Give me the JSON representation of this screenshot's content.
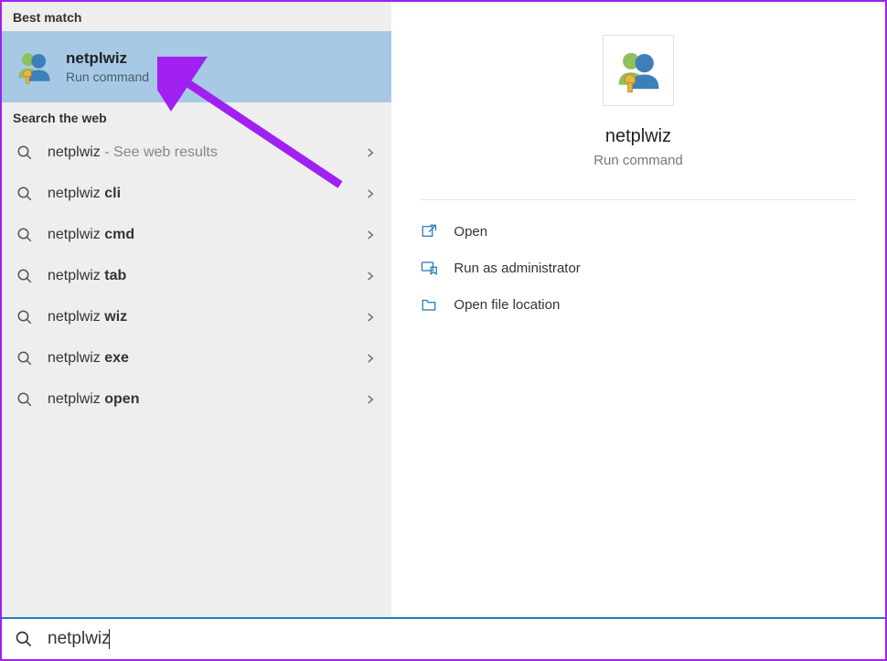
{
  "colors": {
    "accent": "#a020f0",
    "highlight": "#a7c9e6",
    "action_icon": "#1976b2"
  },
  "left": {
    "best_match_header": "Best match",
    "best_match": {
      "title": "netplwiz",
      "subtitle": "Run command"
    },
    "web_header": "Search the web",
    "web_results": [
      {
        "prefix": "netplwiz",
        "bold": "",
        "suffix": " - See web results",
        "suffix_muted": true
      },
      {
        "prefix": "netplwiz ",
        "bold": "cli",
        "suffix": ""
      },
      {
        "prefix": "netplwiz ",
        "bold": "cmd",
        "suffix": ""
      },
      {
        "prefix": "netplwiz ",
        "bold": "tab",
        "suffix": ""
      },
      {
        "prefix": "netplwiz ",
        "bold": "wiz",
        "suffix": ""
      },
      {
        "prefix": "netplwiz ",
        "bold": "exe",
        "suffix": ""
      },
      {
        "prefix": "netplwiz ",
        "bold": "open",
        "suffix": ""
      }
    ]
  },
  "right": {
    "title": "netplwiz",
    "subtitle": "Run command",
    "actions": [
      {
        "icon": "open",
        "label": "Open"
      },
      {
        "icon": "admin",
        "label": "Run as administrator"
      },
      {
        "icon": "folder",
        "label": "Open file location"
      }
    ]
  },
  "search": {
    "value": "netplwiz"
  }
}
